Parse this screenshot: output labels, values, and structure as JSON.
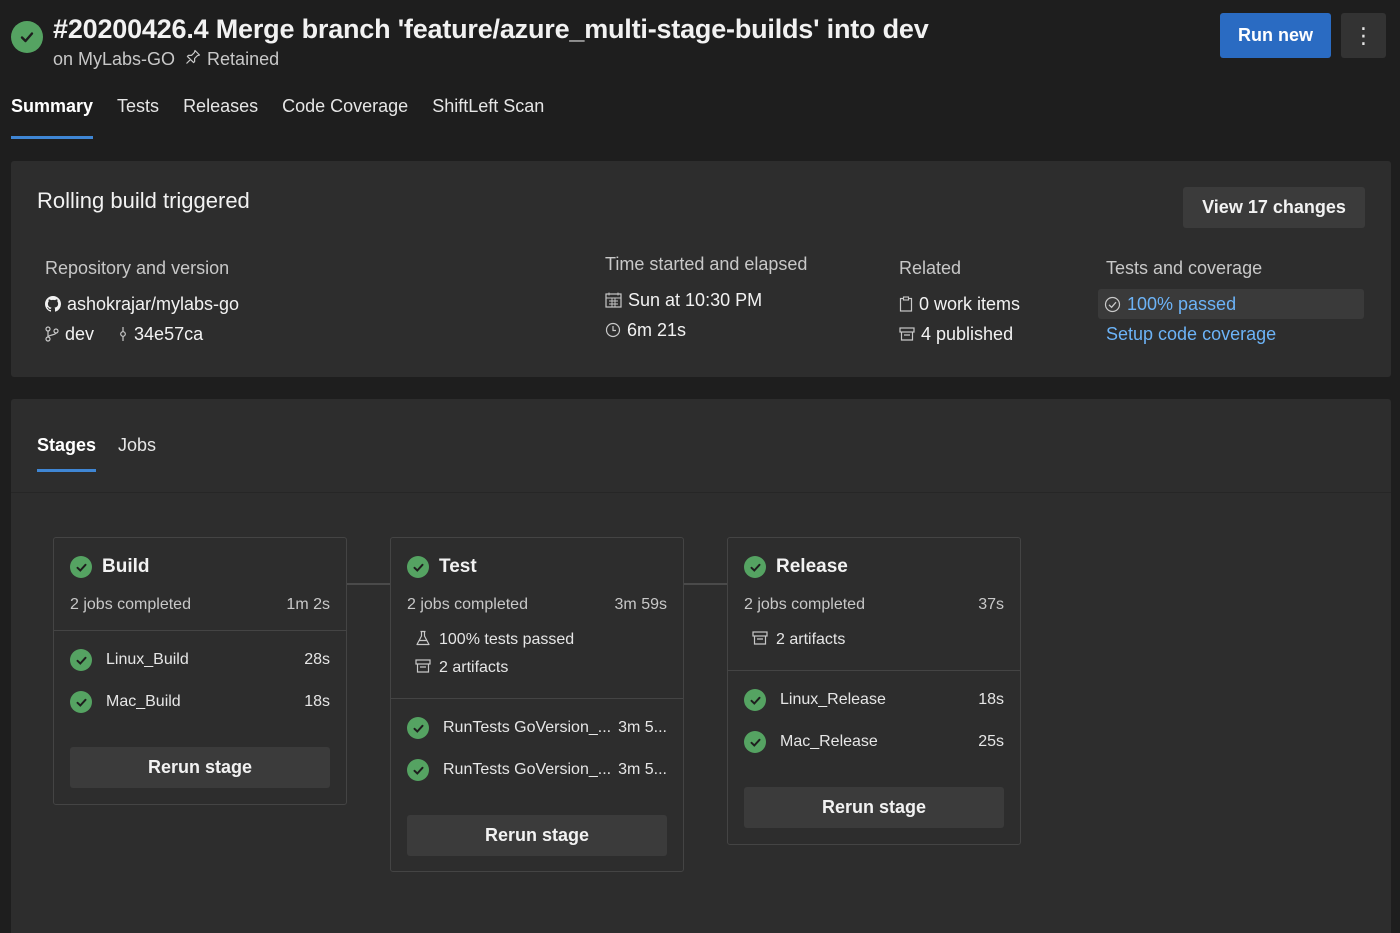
{
  "header": {
    "title": "#20200426.4 Merge branch 'feature/azure_multi-stage-builds' into dev",
    "project": "on MyLabs-GO",
    "retained": "Retained",
    "run_new_label": "Run new",
    "more_label": "⋮",
    "tabs": [
      "Summary",
      "Tests",
      "Releases",
      "Code Coverage",
      "ShiftLeft Scan"
    ],
    "active_tab": "Summary"
  },
  "summary": {
    "heading": "Rolling build triggered",
    "view_changes_label": "View 17 changes",
    "repository": {
      "label": "Repository and version",
      "repo": "ashokrajar/mylabs-go",
      "branch": "dev",
      "commit": "34e57ca"
    },
    "time": {
      "label": "Time started and elapsed",
      "started": "Sun at 10:30 PM",
      "elapsed": "6m 21s"
    },
    "related": {
      "label": "Related",
      "work_items": "0 work items",
      "published": "4 published"
    },
    "tests": {
      "label": "Tests and coverage",
      "passed": "100% passed",
      "coverage_link": "Setup code coverage"
    }
  },
  "stages_panel": {
    "tabs": [
      "Stages",
      "Jobs"
    ],
    "active_tab": "Stages",
    "stages": [
      {
        "name": "Build",
        "summary": "2 jobs completed",
        "duration": "1m 2s",
        "extras": [],
        "jobs": [
          {
            "name": "Linux_Build",
            "duration": "28s"
          },
          {
            "name": "Mac_Build",
            "duration": "18s"
          }
        ],
        "rerun_label": "Rerun stage"
      },
      {
        "name": "Test",
        "summary": "2 jobs completed",
        "duration": "3m 59s",
        "extras": [
          "100% tests passed",
          "2 artifacts"
        ],
        "jobs": [
          {
            "name": "RunTests GoVersion_...",
            "duration": "3m 5..."
          },
          {
            "name": "RunTests GoVersion_...",
            "duration": "3m 5..."
          }
        ],
        "rerun_label": "Rerun stage"
      },
      {
        "name": "Release",
        "summary": "2 jobs completed",
        "duration": "37s",
        "extras": [
          "2 artifacts"
        ],
        "jobs": [
          {
            "name": "Linux_Release",
            "duration": "18s"
          },
          {
            "name": "Mac_Release",
            "duration": "25s"
          }
        ],
        "rerun_label": "Rerun stage"
      }
    ]
  },
  "colors": {
    "success": "#55a362",
    "primary_button": "#2a6bc2",
    "link": "#6cb3f7",
    "tab_underline": "#3f86d4"
  }
}
